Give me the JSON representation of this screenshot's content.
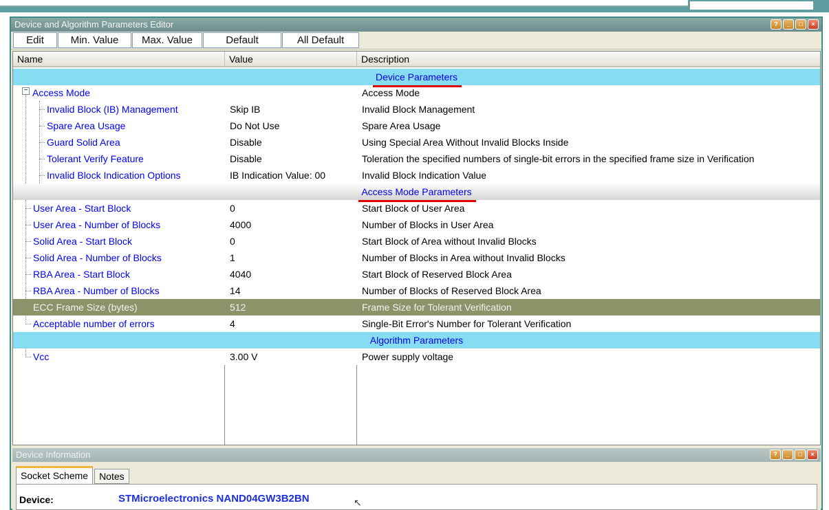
{
  "window": {
    "title": "Device and Algorithm Parameters Editor"
  },
  "toolbar": {
    "edit": "Edit",
    "min_value": "Min. Value",
    "max_value": "Max. Value",
    "default": "Default",
    "all_default": "All Default"
  },
  "table": {
    "headers": {
      "name": "Name",
      "value": "Value",
      "description": "Description"
    },
    "sections": {
      "device": "Device Parameters",
      "access_mode": "Access Mode Parameters",
      "algorithm": "Algorithm Parameters"
    },
    "rows": [
      {
        "name": "Access Mode",
        "value": "",
        "description": "Access Mode"
      },
      {
        "name": "Invalid Block (IB) Management",
        "value": "Skip IB",
        "description": "Invalid Block Management"
      },
      {
        "name": "Spare Area Usage",
        "value": "Do Not Use",
        "description": "Spare Area Usage"
      },
      {
        "name": "Guard Solid Area",
        "value": "Disable",
        "description": "Using Special Area Without Invalid Blocks Inside"
      },
      {
        "name": "Tolerant Verify Feature",
        "value": "Disable",
        "description": "Toleration the specified numbers of single-bit errors in the specified frame size in Verification"
      },
      {
        "name": "Invalid Block Indication Options",
        "value": "IB Indication Value: 00",
        "description": "Invalid Block Indication Value"
      },
      {
        "name": "User Area - Start Block",
        "value": "0",
        "description": "Start Block of User Area"
      },
      {
        "name": "User Area - Number of Blocks",
        "value": "4000",
        "description": "Number of Blocks in User Area"
      },
      {
        "name": "Solid Area - Start Block",
        "value": "0",
        "description": "Start Block of Area without Invalid Blocks"
      },
      {
        "name": "Solid Area - Number of Blocks",
        "value": "1",
        "description": "Number of Blocks in Area without Invalid Blocks"
      },
      {
        "name": "RBA Area - Start Block",
        "value": "4040",
        "description": "Start Block of Reserved Block Area"
      },
      {
        "name": "RBA Area - Number of Blocks",
        "value": "14",
        "description": "Number of Blocks of Reserved Block Area"
      },
      {
        "name": "ECC Frame Size (bytes)",
        "value": "512",
        "description": "Frame Size for Tolerant Verification"
      },
      {
        "name": "Acceptable number of errors",
        "value": "4",
        "description": "Single-Bit Error's Number for Tolerant Verification"
      },
      {
        "name": "Vcc",
        "value": "3.00 V",
        "description": "Power supply voltage"
      }
    ]
  },
  "device_info": {
    "title": "Device Information",
    "tabs": [
      "Socket Scheme",
      "Notes"
    ],
    "device_label": "Device:",
    "device_value": "STMicroelectronics NAND04GW3B2BN"
  },
  "colors": {
    "section_cyan": "#86dcf0",
    "selected_row": "#8b9468",
    "link_blue": "#0000ff",
    "underline_red": "#e00000"
  },
  "icons": [
    "help-icon",
    "minimize-icon",
    "maximize-icon",
    "close-icon",
    "tree-collapse-icon",
    "mouse-cursor-icon"
  ]
}
